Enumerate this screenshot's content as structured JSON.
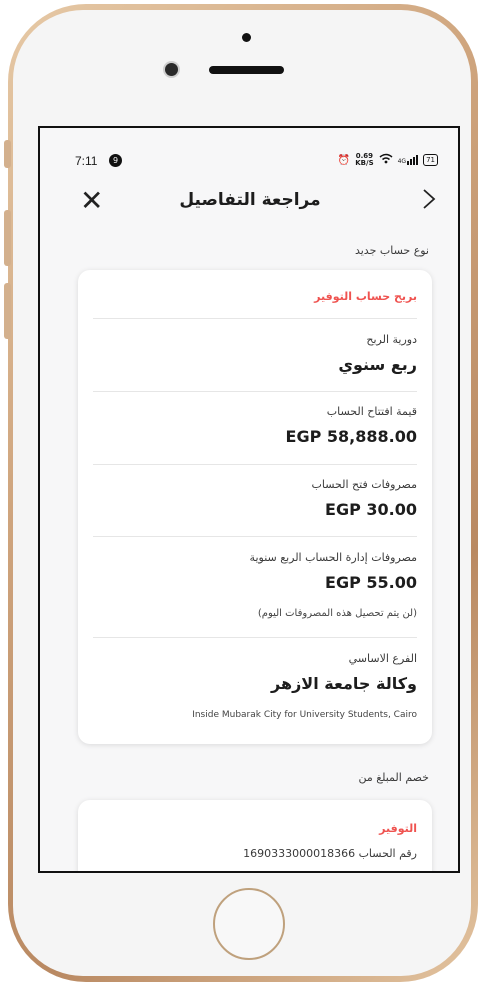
{
  "status_bar": {
    "time": "7:11",
    "notification_count": "9",
    "network_speed": "0.69",
    "network_unit": "KB/S",
    "signal": "4G",
    "battery": "71"
  },
  "header": {
    "title": "مراجعة التفاصيل"
  },
  "account_section": {
    "label": "نوع حساب جديد",
    "product": "بريح حساب التوفير",
    "fields": [
      {
        "label": "دورية الربح",
        "value": "ربع سنوي"
      },
      {
        "label": "قيمة افتتاح الحساب",
        "value": "EGP 58,888.00"
      },
      {
        "label": "مصروفات فتح الحساب",
        "value": "EGP 30.00"
      },
      {
        "label": "مصروفات إدارة الحساب الربع سنوية",
        "value": "EGP 55.00",
        "note": "(لن يتم تحصيل هذه المصروفات اليوم)"
      },
      {
        "label": "الفرع الاساسي",
        "value": "وكالة جامعة الازهر",
        "address": "Inside Mubarak City for University Students, Cairo"
      }
    ]
  },
  "debit_section": {
    "label": "خصم المبلغ من",
    "account_name": "التوفير",
    "account_number_label": "رقم الحساب 1690333000018366"
  },
  "colors": {
    "accent": "#ef5350",
    "text": "#1d1d1d",
    "background": "#f7f7f8"
  }
}
